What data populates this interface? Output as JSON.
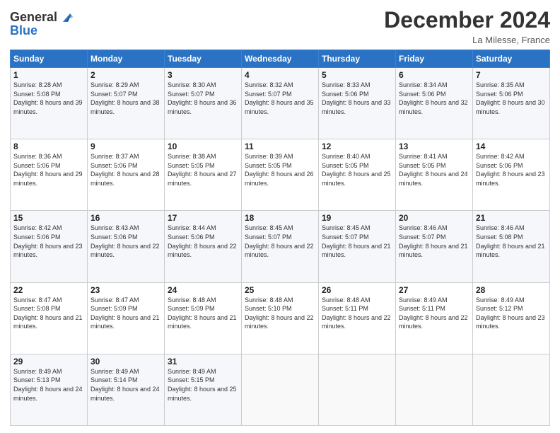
{
  "header": {
    "logo_line1": "General",
    "logo_line2": "Blue",
    "month_title": "December 2024",
    "location": "La Milesse, France"
  },
  "days_of_week": [
    "Sunday",
    "Monday",
    "Tuesday",
    "Wednesday",
    "Thursday",
    "Friday",
    "Saturday"
  ],
  "weeks": [
    [
      {
        "day": "1",
        "sunrise": "8:28 AM",
        "sunset": "5:08 PM",
        "daylight": "8 hours and 39 minutes."
      },
      {
        "day": "2",
        "sunrise": "8:29 AM",
        "sunset": "5:07 PM",
        "daylight": "8 hours and 38 minutes."
      },
      {
        "day": "3",
        "sunrise": "8:30 AM",
        "sunset": "5:07 PM",
        "daylight": "8 hours and 36 minutes."
      },
      {
        "day": "4",
        "sunrise": "8:32 AM",
        "sunset": "5:07 PM",
        "daylight": "8 hours and 35 minutes."
      },
      {
        "day": "5",
        "sunrise": "8:33 AM",
        "sunset": "5:06 PM",
        "daylight": "8 hours and 33 minutes."
      },
      {
        "day": "6",
        "sunrise": "8:34 AM",
        "sunset": "5:06 PM",
        "daylight": "8 hours and 32 minutes."
      },
      {
        "day": "7",
        "sunrise": "8:35 AM",
        "sunset": "5:06 PM",
        "daylight": "8 hours and 30 minutes."
      }
    ],
    [
      {
        "day": "8",
        "sunrise": "8:36 AM",
        "sunset": "5:06 PM",
        "daylight": "8 hours and 29 minutes."
      },
      {
        "day": "9",
        "sunrise": "8:37 AM",
        "sunset": "5:06 PM",
        "daylight": "8 hours and 28 minutes."
      },
      {
        "day": "10",
        "sunrise": "8:38 AM",
        "sunset": "5:05 PM",
        "daylight": "8 hours and 27 minutes."
      },
      {
        "day": "11",
        "sunrise": "8:39 AM",
        "sunset": "5:05 PM",
        "daylight": "8 hours and 26 minutes."
      },
      {
        "day": "12",
        "sunrise": "8:40 AM",
        "sunset": "5:05 PM",
        "daylight": "8 hours and 25 minutes."
      },
      {
        "day": "13",
        "sunrise": "8:41 AM",
        "sunset": "5:05 PM",
        "daylight": "8 hours and 24 minutes."
      },
      {
        "day": "14",
        "sunrise": "8:42 AM",
        "sunset": "5:06 PM",
        "daylight": "8 hours and 23 minutes."
      }
    ],
    [
      {
        "day": "15",
        "sunrise": "8:42 AM",
        "sunset": "5:06 PM",
        "daylight": "8 hours and 23 minutes."
      },
      {
        "day": "16",
        "sunrise": "8:43 AM",
        "sunset": "5:06 PM",
        "daylight": "8 hours and 22 minutes."
      },
      {
        "day": "17",
        "sunrise": "8:44 AM",
        "sunset": "5:06 PM",
        "daylight": "8 hours and 22 minutes."
      },
      {
        "day": "18",
        "sunrise": "8:45 AM",
        "sunset": "5:07 PM",
        "daylight": "8 hours and 22 minutes."
      },
      {
        "day": "19",
        "sunrise": "8:45 AM",
        "sunset": "5:07 PM",
        "daylight": "8 hours and 21 minutes."
      },
      {
        "day": "20",
        "sunrise": "8:46 AM",
        "sunset": "5:07 PM",
        "daylight": "8 hours and 21 minutes."
      },
      {
        "day": "21",
        "sunrise": "8:46 AM",
        "sunset": "5:08 PM",
        "daylight": "8 hours and 21 minutes."
      }
    ],
    [
      {
        "day": "22",
        "sunrise": "8:47 AM",
        "sunset": "5:08 PM",
        "daylight": "8 hours and 21 minutes."
      },
      {
        "day": "23",
        "sunrise": "8:47 AM",
        "sunset": "5:09 PM",
        "daylight": "8 hours and 21 minutes."
      },
      {
        "day": "24",
        "sunrise": "8:48 AM",
        "sunset": "5:09 PM",
        "daylight": "8 hours and 21 minutes."
      },
      {
        "day": "25",
        "sunrise": "8:48 AM",
        "sunset": "5:10 PM",
        "daylight": "8 hours and 22 minutes."
      },
      {
        "day": "26",
        "sunrise": "8:48 AM",
        "sunset": "5:11 PM",
        "daylight": "8 hours and 22 minutes."
      },
      {
        "day": "27",
        "sunrise": "8:49 AM",
        "sunset": "5:11 PM",
        "daylight": "8 hours and 22 minutes."
      },
      {
        "day": "28",
        "sunrise": "8:49 AM",
        "sunset": "5:12 PM",
        "daylight": "8 hours and 23 minutes."
      }
    ],
    [
      {
        "day": "29",
        "sunrise": "8:49 AM",
        "sunset": "5:13 PM",
        "daylight": "8 hours and 24 minutes."
      },
      {
        "day": "30",
        "sunrise": "8:49 AM",
        "sunset": "5:14 PM",
        "daylight": "8 hours and 24 minutes."
      },
      {
        "day": "31",
        "sunrise": "8:49 AM",
        "sunset": "5:15 PM",
        "daylight": "8 hours and 25 minutes."
      },
      null,
      null,
      null,
      null
    ]
  ]
}
